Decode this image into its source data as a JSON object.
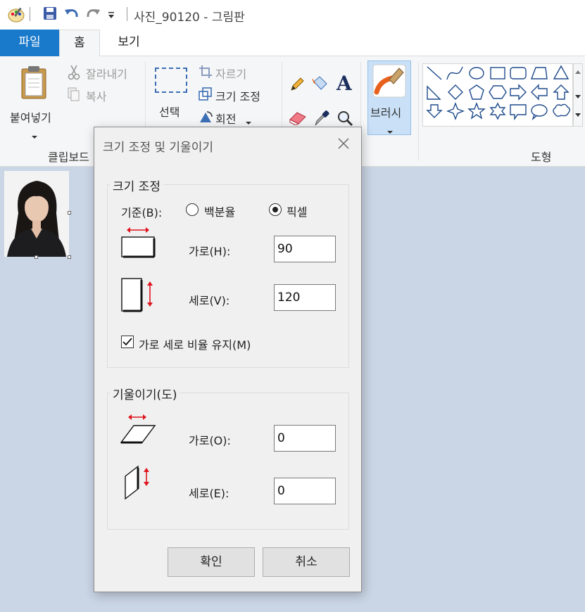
{
  "window": {
    "title": "사진_90120 - 그림판"
  },
  "quick_access": {
    "icons": [
      "paint-app-icon",
      "save-icon",
      "undo-icon",
      "redo-icon",
      "customize-dropdown-icon"
    ]
  },
  "tabs": [
    {
      "label": "파일"
    },
    {
      "label": "홈"
    },
    {
      "label": "보기"
    }
  ],
  "ribbon": {
    "clipboard": {
      "paste": "붙여넣기",
      "cut": "잘라내기",
      "copy": "복사",
      "group": "클립보드"
    },
    "image": {
      "select": "선택",
      "crop": "자르기",
      "resize": "크기 조정",
      "rotate": "회전"
    },
    "brushes": {
      "label": "브러시"
    },
    "shapes": {
      "group": "도형"
    }
  },
  "dialog": {
    "title": "크기 조정 및 기울이기",
    "resize": {
      "section": "크기 조정",
      "by_label": "기준(B):",
      "percent_label": "백분율",
      "pixel_label": "픽셀",
      "selected": "pixel",
      "horizontal_label": "가로(H):",
      "horizontal_value": "90",
      "vertical_label": "세로(V):",
      "vertical_value": "120",
      "keep_ratio_label": "가로 세로 비율 유지(M)",
      "keep_ratio_checked": true
    },
    "skew": {
      "section": "기울이기(도)",
      "horizontal_label": "가로(O):",
      "horizontal_value": "0",
      "vertical_label": "세로(E):",
      "vertical_value": "0"
    },
    "ok": "확인",
    "cancel": "취소"
  },
  "colors": {
    "accent": "#1979ca",
    "canvas_bg": "#cad5e5",
    "brush_selected": "#c9e0f7",
    "arrow": "#e0141e"
  }
}
